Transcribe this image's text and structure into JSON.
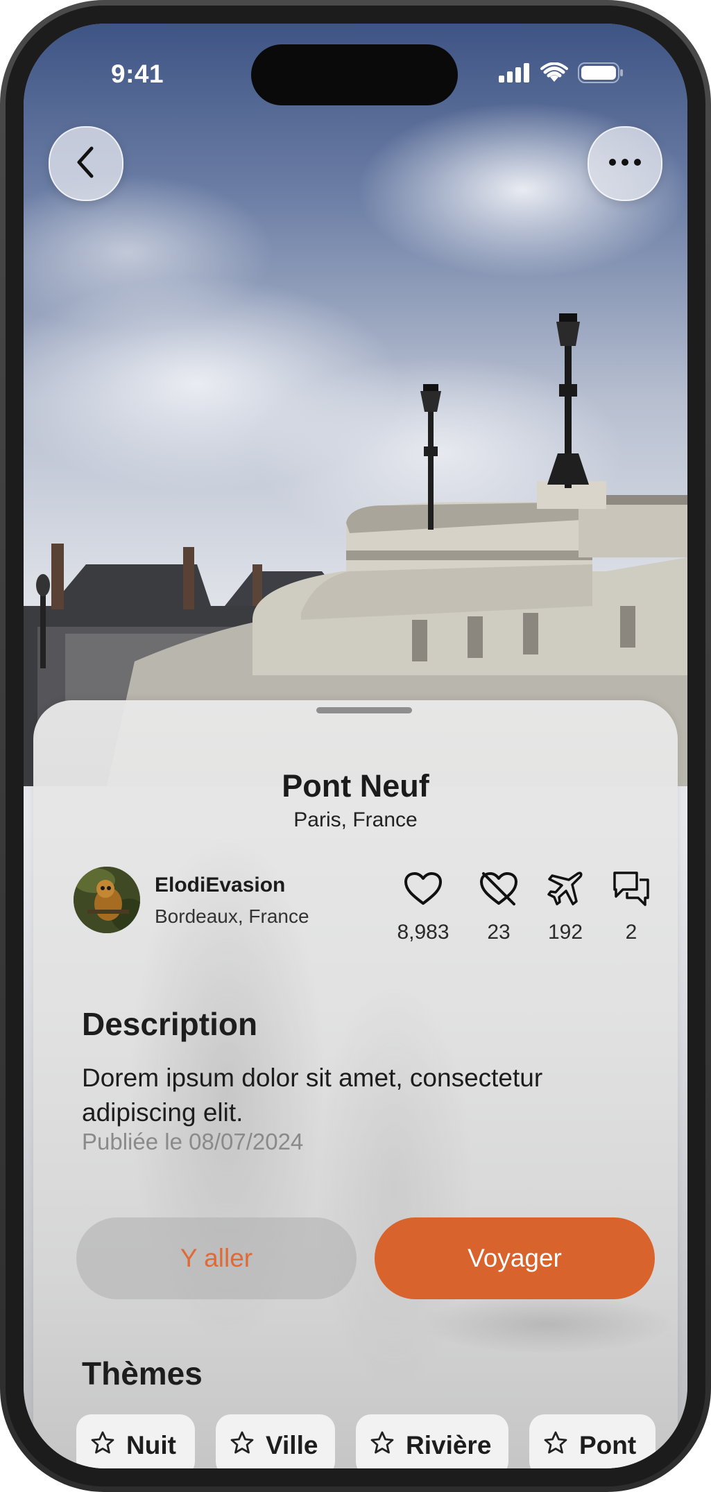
{
  "status_bar": {
    "time": "9:41"
  },
  "header": {
    "back_icon": "chevron-left-icon",
    "more_icon": "ellipsis-icon"
  },
  "place": {
    "title": "Pont Neuf",
    "location": "Paris, France"
  },
  "author": {
    "name": "ElodiEvasion",
    "location": "Bordeaux, France"
  },
  "stats": [
    {
      "icon": "heart-icon",
      "value": "8,983"
    },
    {
      "icon": "heart-off-icon",
      "value": "23"
    },
    {
      "icon": "airplane-icon",
      "value": "192"
    },
    {
      "icon": "comments-icon",
      "value": "2"
    }
  ],
  "description": {
    "heading": "Description",
    "text": "Dorem ipsum dolor sit amet, consectetur adipiscing elit.",
    "published": "Publiée le 08/07/2024"
  },
  "actions": {
    "secondary_label": "Y aller",
    "primary_label": "Voyager"
  },
  "themes": {
    "heading": "Thèmes",
    "chips": [
      "Nuit",
      "Ville",
      "Rivière",
      "Pont"
    ]
  },
  "colors": {
    "accent": "#d8632c",
    "text": "#1d1d1d",
    "muted": "#8a8a8a"
  }
}
